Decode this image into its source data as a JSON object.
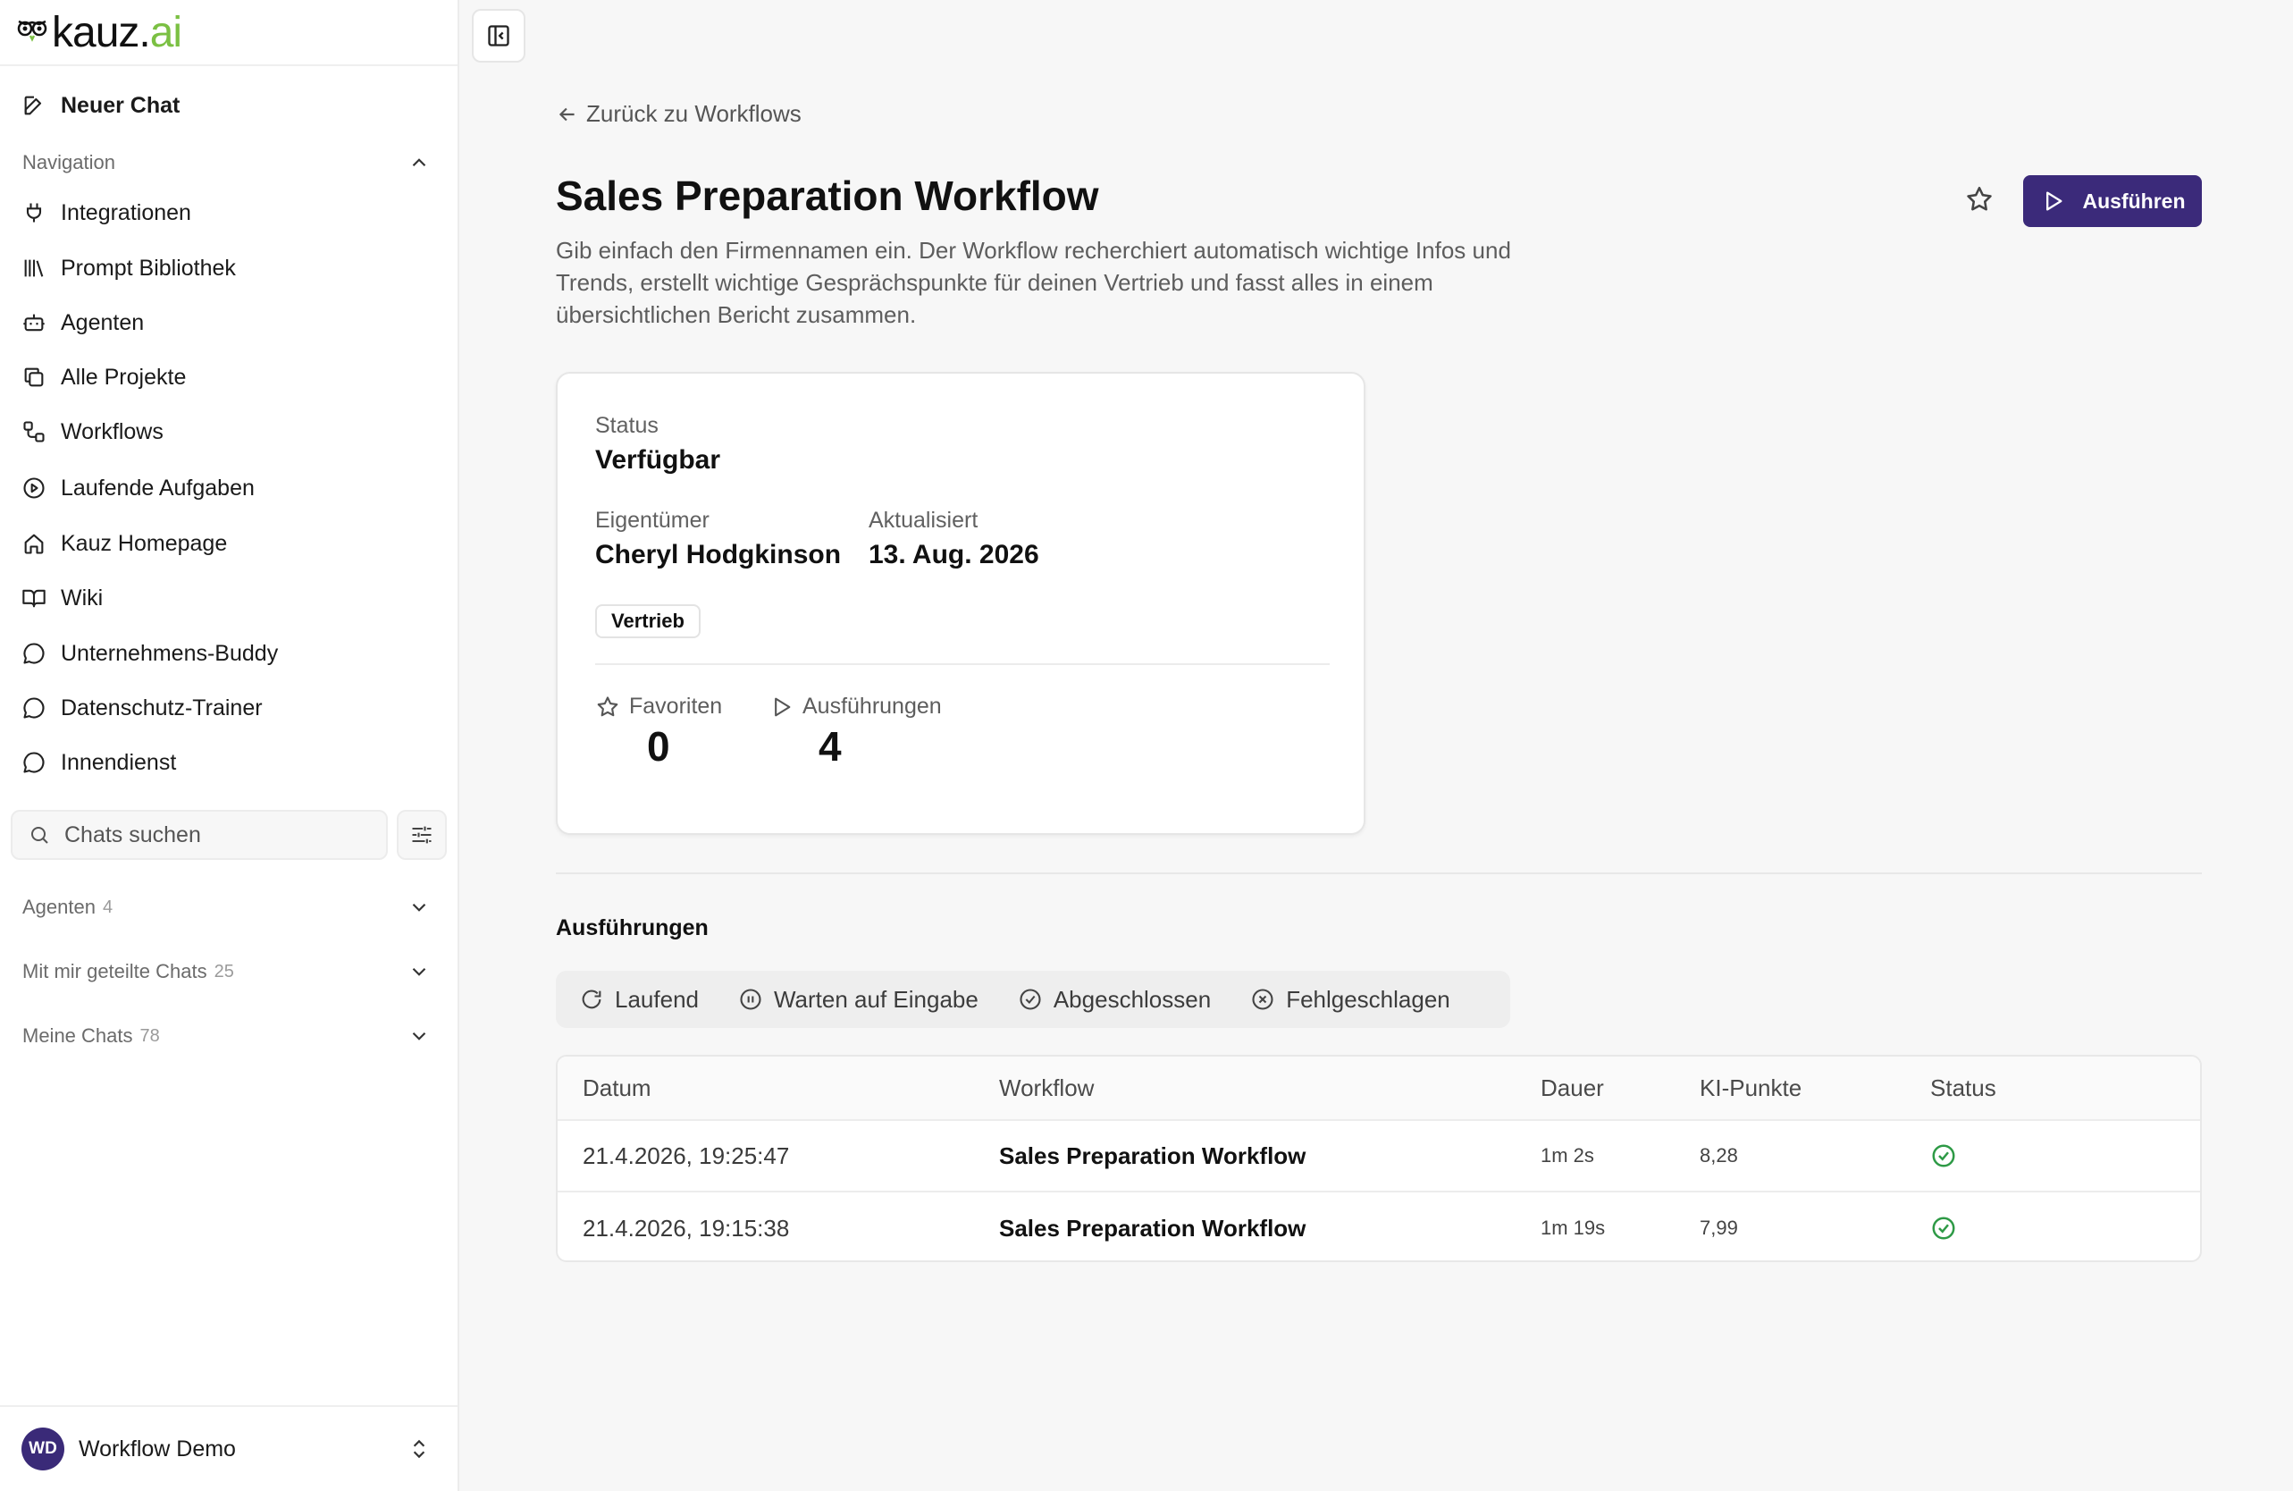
{
  "brand": {
    "logo_dark": "kauz.",
    "logo_green": "ai",
    "accent": "#3b2a7a",
    "logo_green_color": "#7bc043"
  },
  "sidebar": {
    "new_chat": "Neuer Chat",
    "navigation_label": "Navigation",
    "items": [
      {
        "label": "Integrationen",
        "icon": "plug-icon"
      },
      {
        "label": "Prompt Bibliothek",
        "icon": "library-icon"
      },
      {
        "label": "Agenten",
        "icon": "bot-icon"
      },
      {
        "label": "Alle Projekte",
        "icon": "copy-icon"
      },
      {
        "label": "Workflows",
        "icon": "workflow-icon"
      },
      {
        "label": "Laufende Aufgaben",
        "icon": "play-circle-icon"
      },
      {
        "label": "Kauz Homepage",
        "icon": "home-icon"
      },
      {
        "label": "Wiki",
        "icon": "book-icon"
      },
      {
        "label": "Unternehmens-Buddy",
        "icon": "chat-bubble-icon"
      },
      {
        "label": "Datenschutz-Trainer",
        "icon": "chat-bubble-icon"
      },
      {
        "label": "Innendienst",
        "icon": "chat-bubble-icon"
      }
    ],
    "search_placeholder": "Chats suchen",
    "groups": [
      {
        "label": "Agenten",
        "count": "4"
      },
      {
        "label": "Mit mir geteilte Chats",
        "count": "25"
      },
      {
        "label": "Meine Chats",
        "count": "78"
      }
    ],
    "user": {
      "initials": "WD",
      "name": "Workflow Demo"
    }
  },
  "main": {
    "back_link": "Zurück zu Workflows",
    "title": "Sales Preparation Workflow",
    "description": "Gib einfach den Firmennamen ein. Der Workflow recherchiert automatisch wichtige Infos und Trends, erstellt wichtige Gesprächspunkte für deinen Vertrieb und fasst alles in einem übersichtlichen Bericht zusammen.",
    "run_button": "Ausführen",
    "card": {
      "status_label": "Status",
      "status_value": "Verfügbar",
      "owner_label": "Eigentümer",
      "owner_value": "Cheryl Hodgkinson",
      "updated_label": "Aktualisiert",
      "updated_value": "13. Aug. 2026",
      "tag": "Vertrieb",
      "favorites_label": "Favoriten",
      "favorites_value": "0",
      "runs_label": "Ausführungen",
      "runs_value": "4"
    },
    "executions_heading": "Ausführungen",
    "filter_tabs": [
      {
        "label": "Laufend",
        "icon": "refresh-icon"
      },
      {
        "label": "Warten auf Eingabe",
        "icon": "pause-circle-icon"
      },
      {
        "label": "Abgeschlossen",
        "icon": "check-circle-icon"
      },
      {
        "label": "Fehlgeschlagen",
        "icon": "x-circle-icon"
      }
    ],
    "table": {
      "headers": [
        "Datum",
        "Workflow",
        "Dauer",
        "KI-Punkte",
        "Status"
      ],
      "rows": [
        {
          "date": "21.4.2026, 19:25:47",
          "workflow": "Sales Preparation Workflow",
          "duration": "1m 2s",
          "points": "8,28",
          "status": "success"
        },
        {
          "date": "21.4.2026, 19:15:38",
          "workflow": "Sales Preparation Workflow",
          "duration": "1m 19s",
          "points": "7,99",
          "status": "success"
        }
      ]
    },
    "status_color_success": "#2e9a46"
  }
}
